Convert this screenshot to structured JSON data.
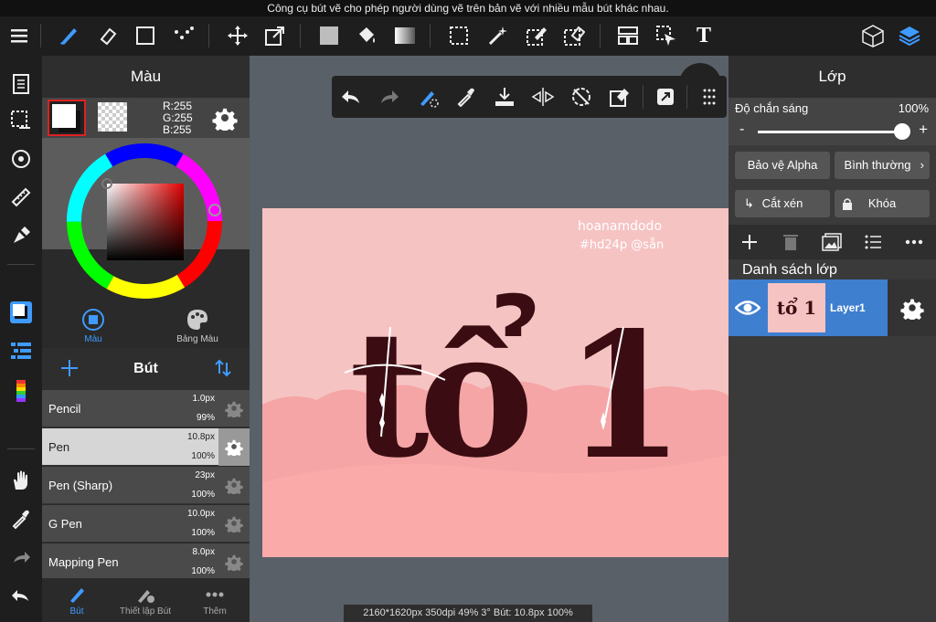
{
  "tooltip": "Công cụ bút vẽ cho phép người dùng vẽ trên bản vẽ với nhiều mẫu bút khác nhau.",
  "toolbar": {
    "icons": [
      "menu-icon",
      "pen-tool-icon",
      "eraser-icon",
      "rectangle-icon",
      "dot-tool-icon",
      "move-icon",
      "transform-icon",
      "fill-color-icon",
      "bucket-icon",
      "gradient-icon",
      "select-rect-icon",
      "magic-wand-icon",
      "select-pen-icon",
      "select-eraser-icon",
      "frame-icon",
      "select-arrow-icon",
      "text-icon",
      "3d-icon",
      "layers-icon"
    ],
    "text_label": "T"
  },
  "color_panel": {
    "title": "Màu",
    "r": "R:255",
    "g": "G:255",
    "b": "B:255",
    "tabs": [
      {
        "label": "Màu"
      },
      {
        "label": "Bảng Màu"
      }
    ]
  },
  "brush_panel": {
    "title": "Bút",
    "brushes": [
      {
        "name": "Pencil",
        "size": "1.0px",
        "opacity": "99%"
      },
      {
        "name": "Pen",
        "size": "10.8px",
        "opacity": "100%"
      },
      {
        "name": "Pen (Sharp)",
        "size": "23px",
        "opacity": "100%"
      },
      {
        "name": "G Pen",
        "size": "10.0px",
        "opacity": "100%"
      },
      {
        "name": "Mapping Pen",
        "size": "8.0px",
        "opacity": "100%"
      }
    ],
    "selected_index": 1,
    "tabs": [
      {
        "label": "Bút"
      },
      {
        "label": "Thiết lập Bút"
      },
      {
        "label": "Thêm"
      }
    ]
  },
  "canvas": {
    "watermark_line1": "hoanamdodo",
    "watermark_line2": "#hd24p @sẵn",
    "artwork_text_1": "tổ",
    "artwork_text_2": "1"
  },
  "status": "2160*1620px 350dpi 49% 3° Bút: 10.8px 100%",
  "layer_panel": {
    "title": "Lớp",
    "opacity_label": "Độ chắn sáng",
    "opacity_value": "100%",
    "opacity_fraction": 1.0,
    "minus": "-",
    "plus": "+",
    "protect_alpha": "Bảo vệ Alpha",
    "blend_mode": "Bình thường",
    "clipping": "Cắt xén",
    "lock": "Khóa",
    "list_label": "Danh sách lớp",
    "layers": [
      {
        "name": "Layer1",
        "thumb_text": "tổ 1"
      }
    ]
  },
  "colors": {
    "accent": "#3f7fcf",
    "canvas_pink": "#f6c3c3",
    "canvas_pink_dark": "#f5a5a5",
    "ink": "#3b0d12"
  }
}
